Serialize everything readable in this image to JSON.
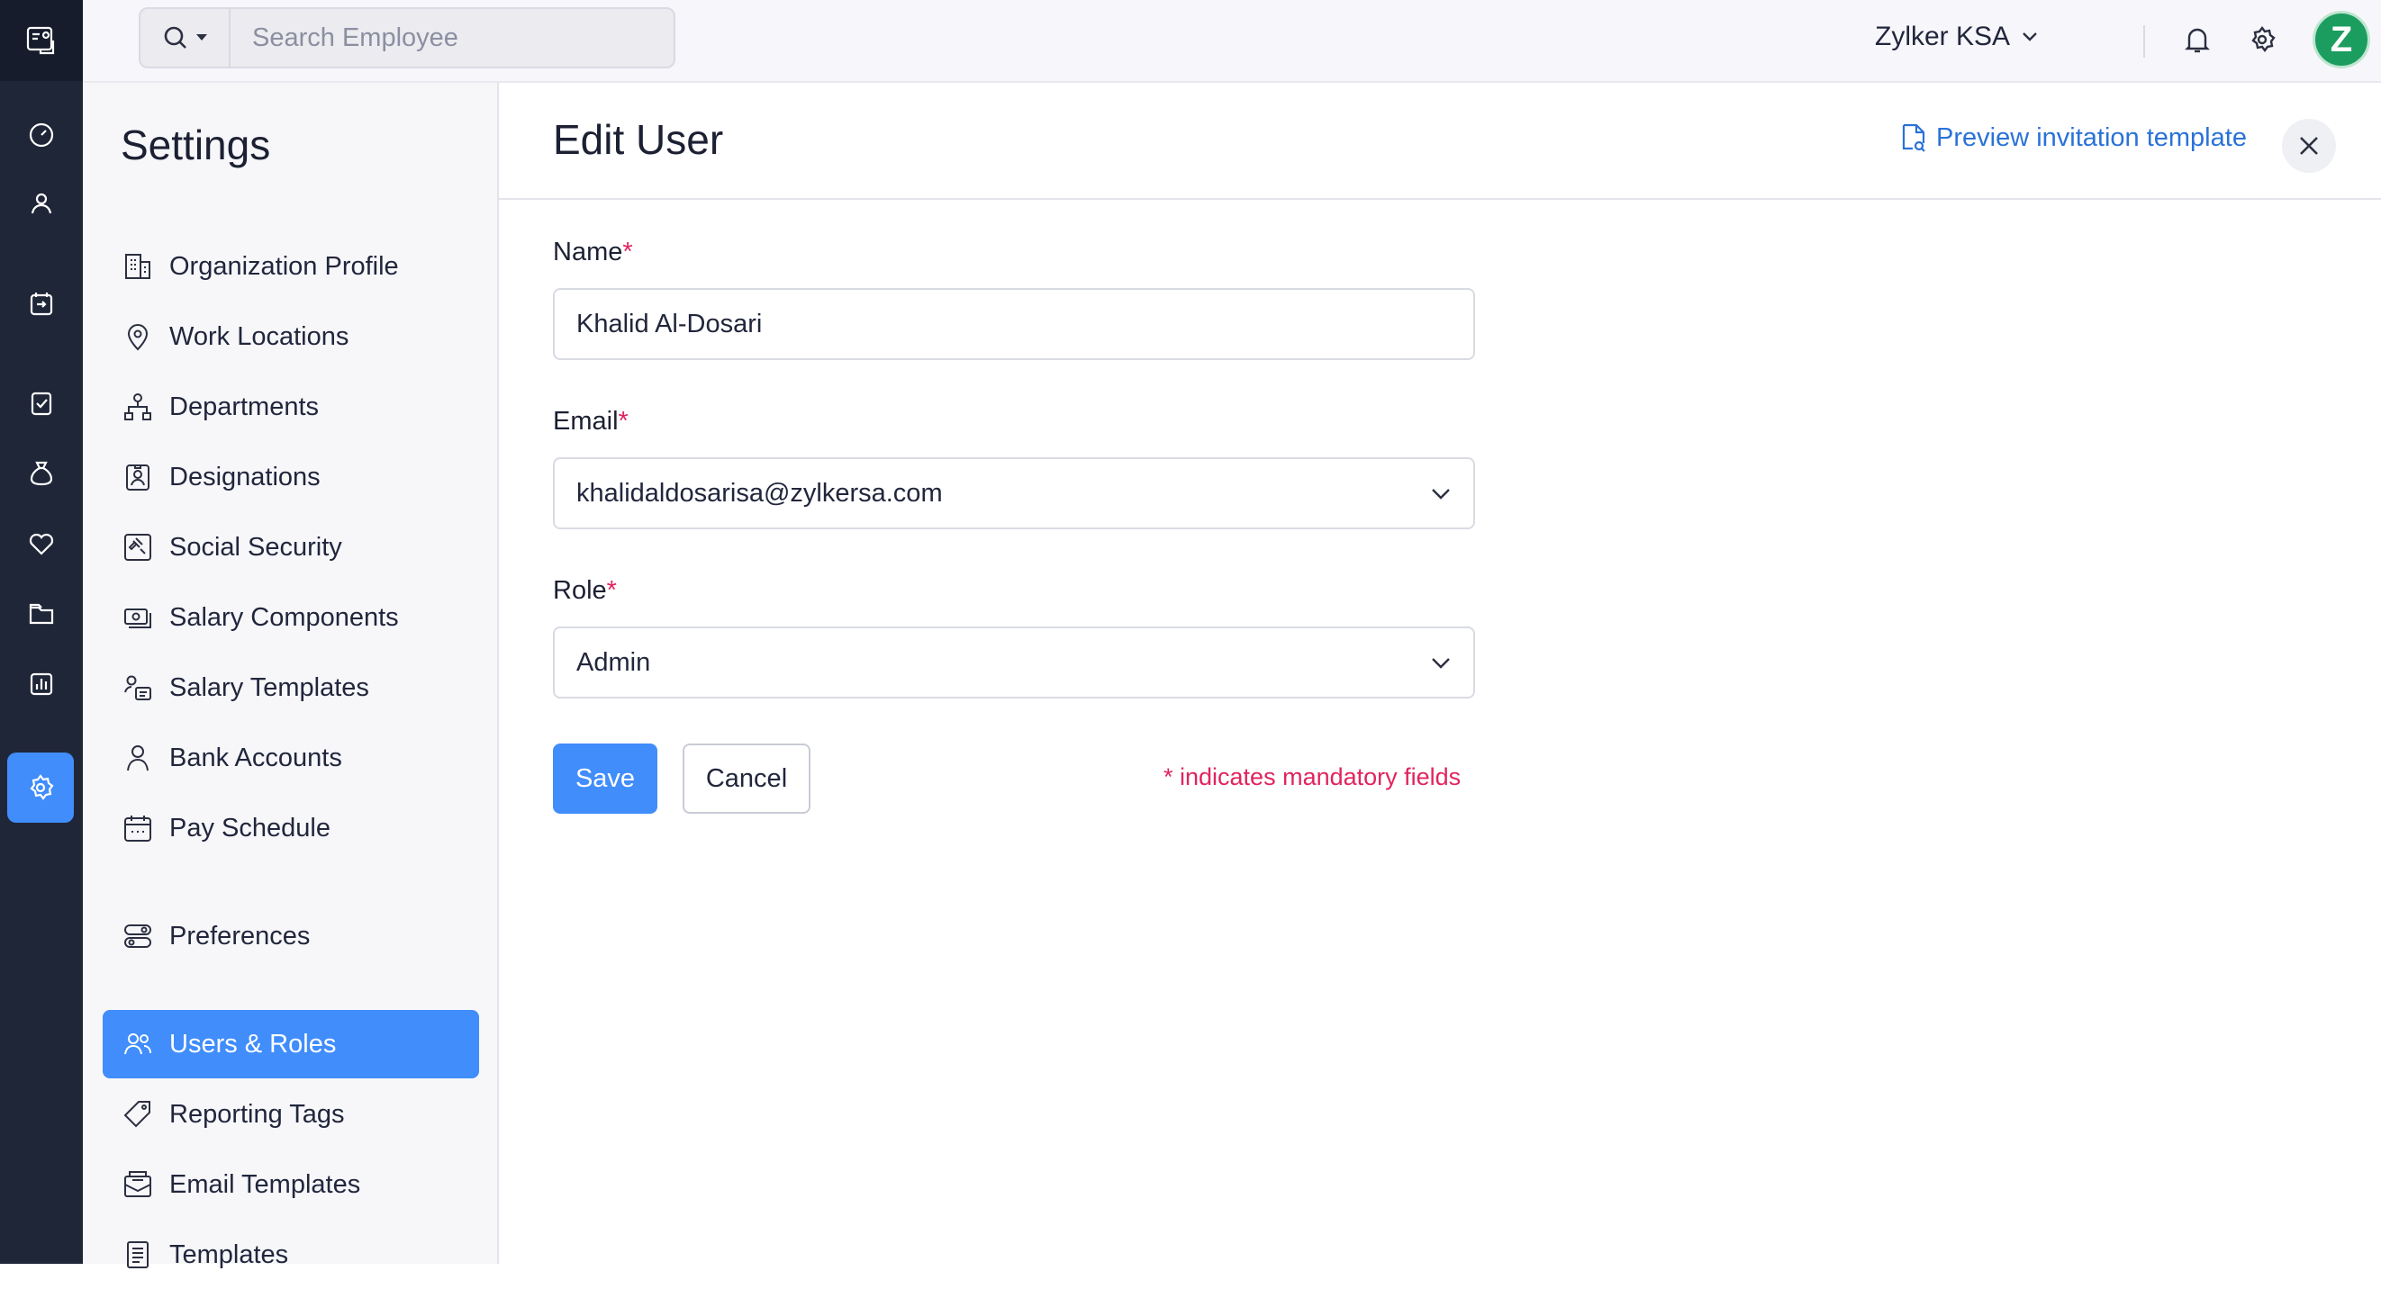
{
  "topbar": {
    "search_placeholder": "Search Employee",
    "org_name": "Zylker KSA",
    "avatar_letter": "Z"
  },
  "rail": {
    "items": [
      "logo-icon",
      "dashboard-icon",
      "employees-icon",
      "pay-runs-icon",
      "approvals-icon",
      "loans-icon",
      "benefits-icon",
      "documents-icon",
      "reports-icon",
      "settings-icon"
    ],
    "active": "settings-icon",
    "accent": "#408dfb"
  },
  "sidebar": {
    "title": "Settings",
    "items": [
      {
        "label": "Organization Profile",
        "icon": "building-icon"
      },
      {
        "label": "Work Locations",
        "icon": "location-pin-icon"
      },
      {
        "label": "Departments",
        "icon": "org-chart-icon"
      },
      {
        "label": "Designations",
        "icon": "id-badge-icon"
      },
      {
        "label": "Social Security",
        "icon": "gavel-icon"
      },
      {
        "label": "Salary Components",
        "icon": "cash-icon"
      },
      {
        "label": "Salary Templates",
        "icon": "user-list-icon"
      },
      {
        "label": "Bank Accounts",
        "icon": "user-icon"
      },
      {
        "label": "Pay Schedule",
        "icon": "calendar-icon"
      },
      {
        "label": "Preferences",
        "icon": "toggles-icon"
      },
      {
        "label": "Users & Roles",
        "icon": "users-icon",
        "active": true
      },
      {
        "label": "Reporting Tags",
        "icon": "tag-icon"
      },
      {
        "label": "Email Templates",
        "icon": "mail-template-icon"
      },
      {
        "label": "Templates",
        "icon": "document-icon"
      }
    ]
  },
  "main": {
    "title": "Edit User",
    "preview_link": "Preview invitation template",
    "form": {
      "name_label": "Name",
      "name_value": "Khalid Al-Dosari",
      "email_label": "Email",
      "email_value": "khalidaldosarisa@zylkersa.com",
      "role_label": "Role",
      "role_value": "Admin",
      "required_marker": "*"
    },
    "save_label": "Save",
    "cancel_label": "Cancel",
    "mandatory_note": "* indicates mandatory fields"
  }
}
